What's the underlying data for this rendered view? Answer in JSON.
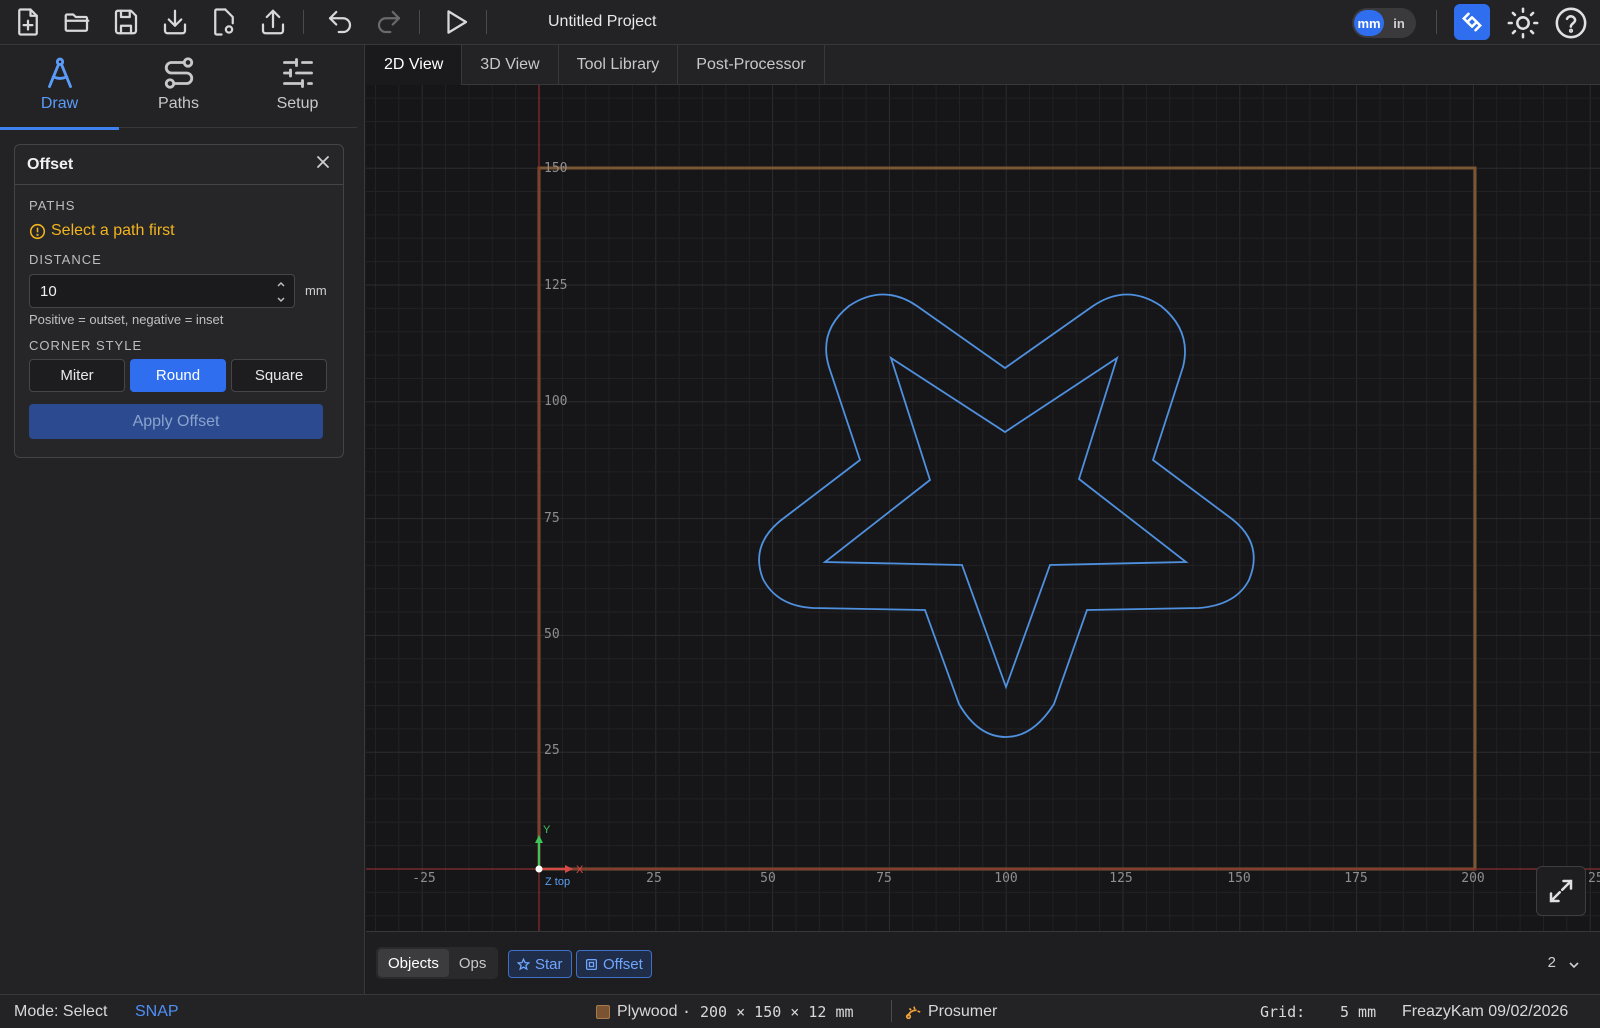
{
  "toolbar": {
    "icons": [
      "new-file-icon",
      "open-folder-icon",
      "save-icon",
      "import-icon",
      "file-settings-icon",
      "export-icon",
      "undo-icon",
      "redo-icon",
      "play-icon"
    ],
    "project_title": "Untitled Project",
    "units": {
      "mm": "mm",
      "in": "in",
      "selected": "mm"
    },
    "accent": "#2f6fef"
  },
  "sidebar": {
    "tabs": [
      {
        "label": "Draw",
        "icon": "compass-icon",
        "active": true
      },
      {
        "label": "Paths",
        "icon": "paths-icon",
        "active": false
      },
      {
        "label": "Setup",
        "icon": "sliders-icon",
        "active": false
      }
    ]
  },
  "offset_panel": {
    "title": "Offset",
    "paths_label": "PATHS",
    "warning": "Select a path first",
    "distance_label": "DISTANCE",
    "distance_value": "10",
    "distance_unit": "mm",
    "hint": "Positive = outset, negative = inset",
    "corner_style_label": "CORNER STYLE",
    "corner_styles": [
      "Miter",
      "Round",
      "Square"
    ],
    "corner_selected": "Round",
    "apply_label": "Apply Offset"
  },
  "view_tabs": [
    {
      "label": "2D View",
      "active": true
    },
    {
      "label": "3D View",
      "active": false
    },
    {
      "label": "Tool Library",
      "active": false
    },
    {
      "label": "Post-Processor",
      "active": false
    }
  ],
  "canvas": {
    "x_ticks": [
      "-25",
      "25",
      "50",
      "75",
      "100",
      "125",
      "150",
      "175",
      "200",
      "25"
    ],
    "y_ticks": [
      "150",
      "125",
      "100",
      "75",
      "50",
      "25"
    ],
    "axis_y": "Y",
    "axis_x": "X",
    "axis_z": "Z top",
    "stock_color": "#7a5632",
    "path_color": "#4f90df"
  },
  "objbar": {
    "segments": [
      "Objects",
      "Ops"
    ],
    "selected_segment": "Objects",
    "chips": [
      {
        "label": "Star",
        "icon": "star-icon"
      },
      {
        "label": "Offset",
        "icon": "offset-icon"
      }
    ],
    "count": "2"
  },
  "status": {
    "mode": "Mode: Select",
    "snap": "SNAP",
    "material": "Plywood",
    "dims": "· 200 × 150 × 12 mm",
    "machine": "Prosumer",
    "grid_label": "Grid:",
    "grid_value": "5 mm",
    "version": "FreazyKam 09/02/2026"
  }
}
